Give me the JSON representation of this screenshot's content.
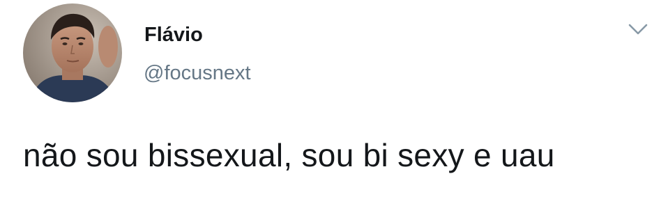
{
  "author": {
    "display_name": "Flávio",
    "handle": "@focusnext"
  },
  "tweet": {
    "text": "não sou bissexual, sou bi sexy e uau"
  },
  "icons": {
    "menu": "chevron-down-icon",
    "avatar": "profile-photo"
  },
  "colors": {
    "text_primary": "#14171a",
    "text_secondary": "#657786",
    "caret": "#8899a6",
    "background": "#ffffff"
  }
}
